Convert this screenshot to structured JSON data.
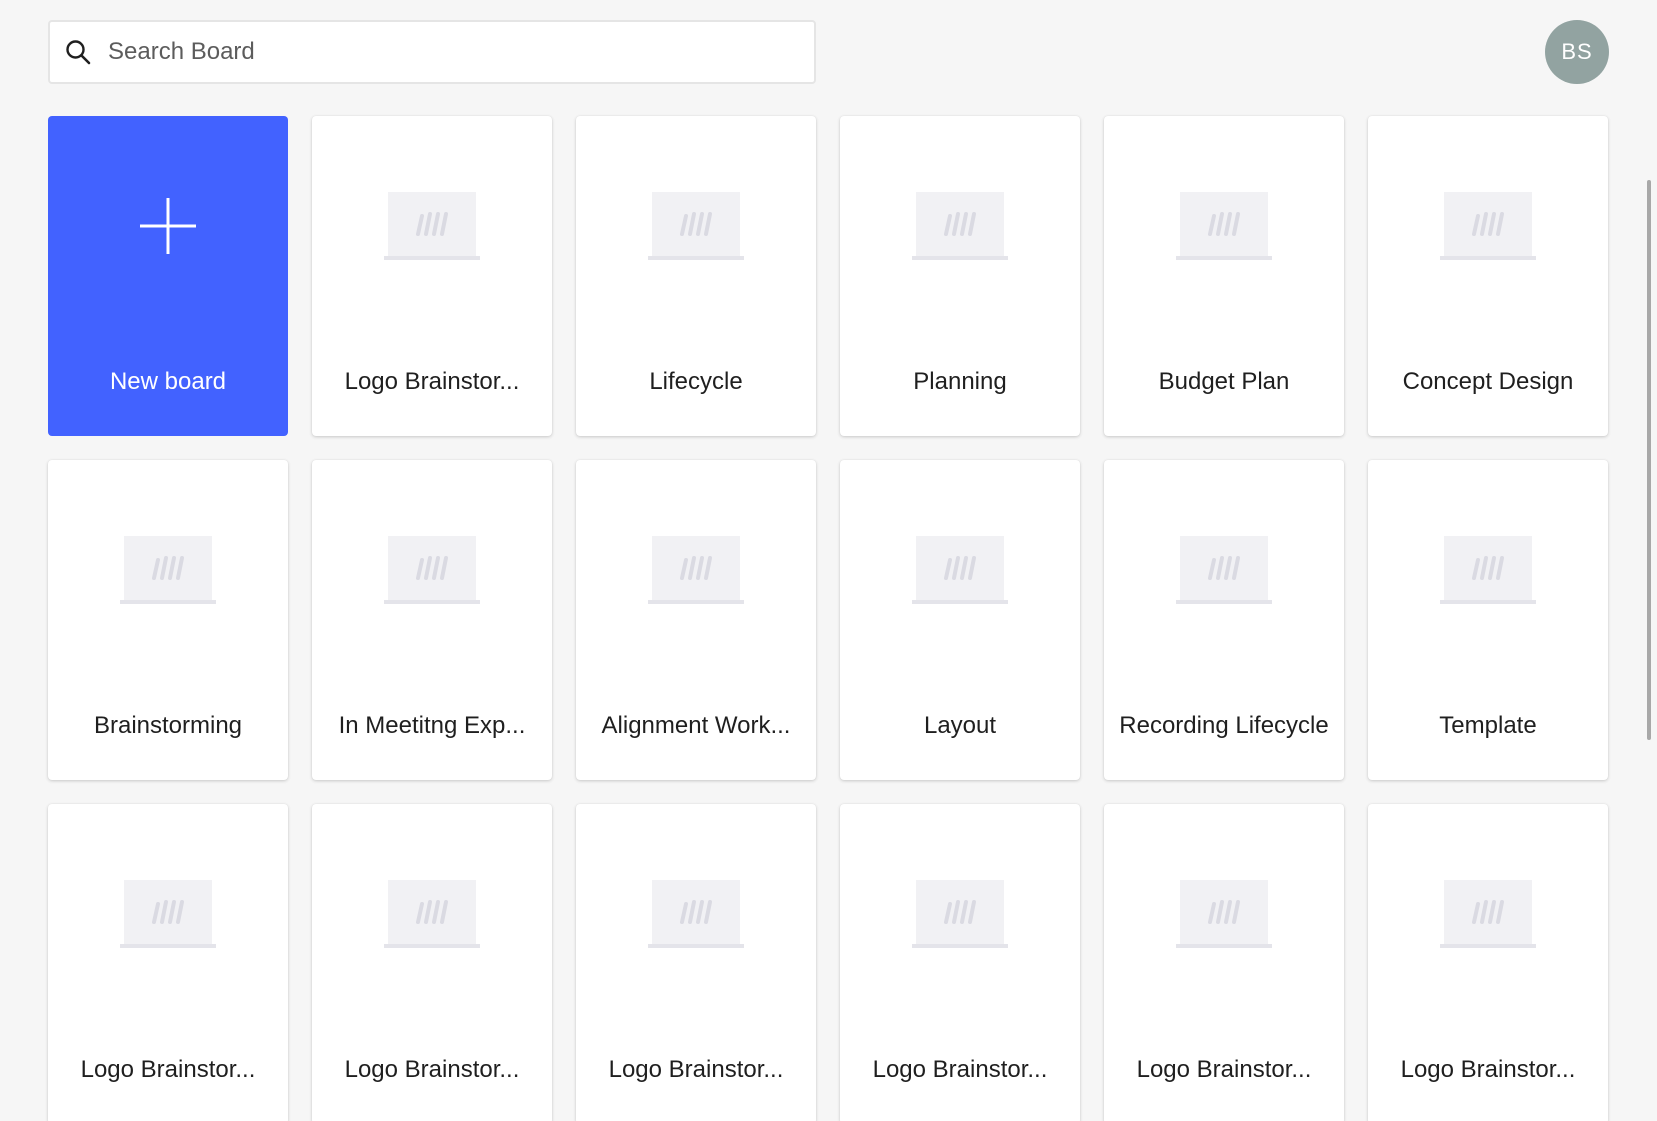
{
  "search": {
    "placeholder": "Search Board",
    "value": ""
  },
  "user": {
    "initials": "BS"
  },
  "colors": {
    "accent": "#4262ff",
    "avatar": "#92a3a1",
    "background": "#f6f6f6"
  },
  "new_board": {
    "label": "New board",
    "icon": "plus-icon"
  },
  "boards": [
    {
      "label": "Logo Brainstor..."
    },
    {
      "label": "Lifecycle"
    },
    {
      "label": "Planning"
    },
    {
      "label": "Budget Plan"
    },
    {
      "label": "Concept Design"
    },
    {
      "label": "Brainstorming"
    },
    {
      "label": "In Meetitng Exp..."
    },
    {
      "label": "Alignment Work..."
    },
    {
      "label": "Layout"
    },
    {
      "label": "Recording Lifecycle"
    },
    {
      "label": "Template"
    },
    {
      "label": "Logo Brainstor..."
    },
    {
      "label": "Logo Brainstor..."
    },
    {
      "label": "Logo Brainstor..."
    },
    {
      "label": "Logo Brainstor..."
    },
    {
      "label": "Logo Brainstor..."
    },
    {
      "label": "Logo Brainstor..."
    }
  ]
}
